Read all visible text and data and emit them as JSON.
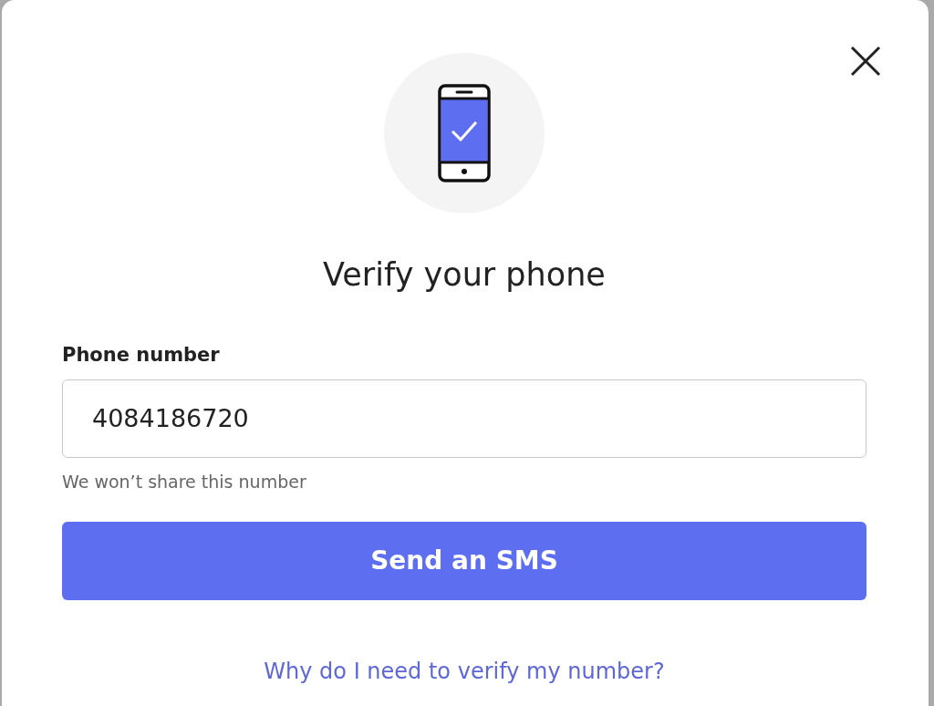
{
  "dialog": {
    "title": "Verify your phone"
  },
  "phone_field": {
    "label": "Phone number",
    "value": "4084186720",
    "hint": "We won’t share this number"
  },
  "submit_button": {
    "label": "Send an SMS"
  },
  "help_link": {
    "label": "Why do I need to verify my number?"
  }
}
